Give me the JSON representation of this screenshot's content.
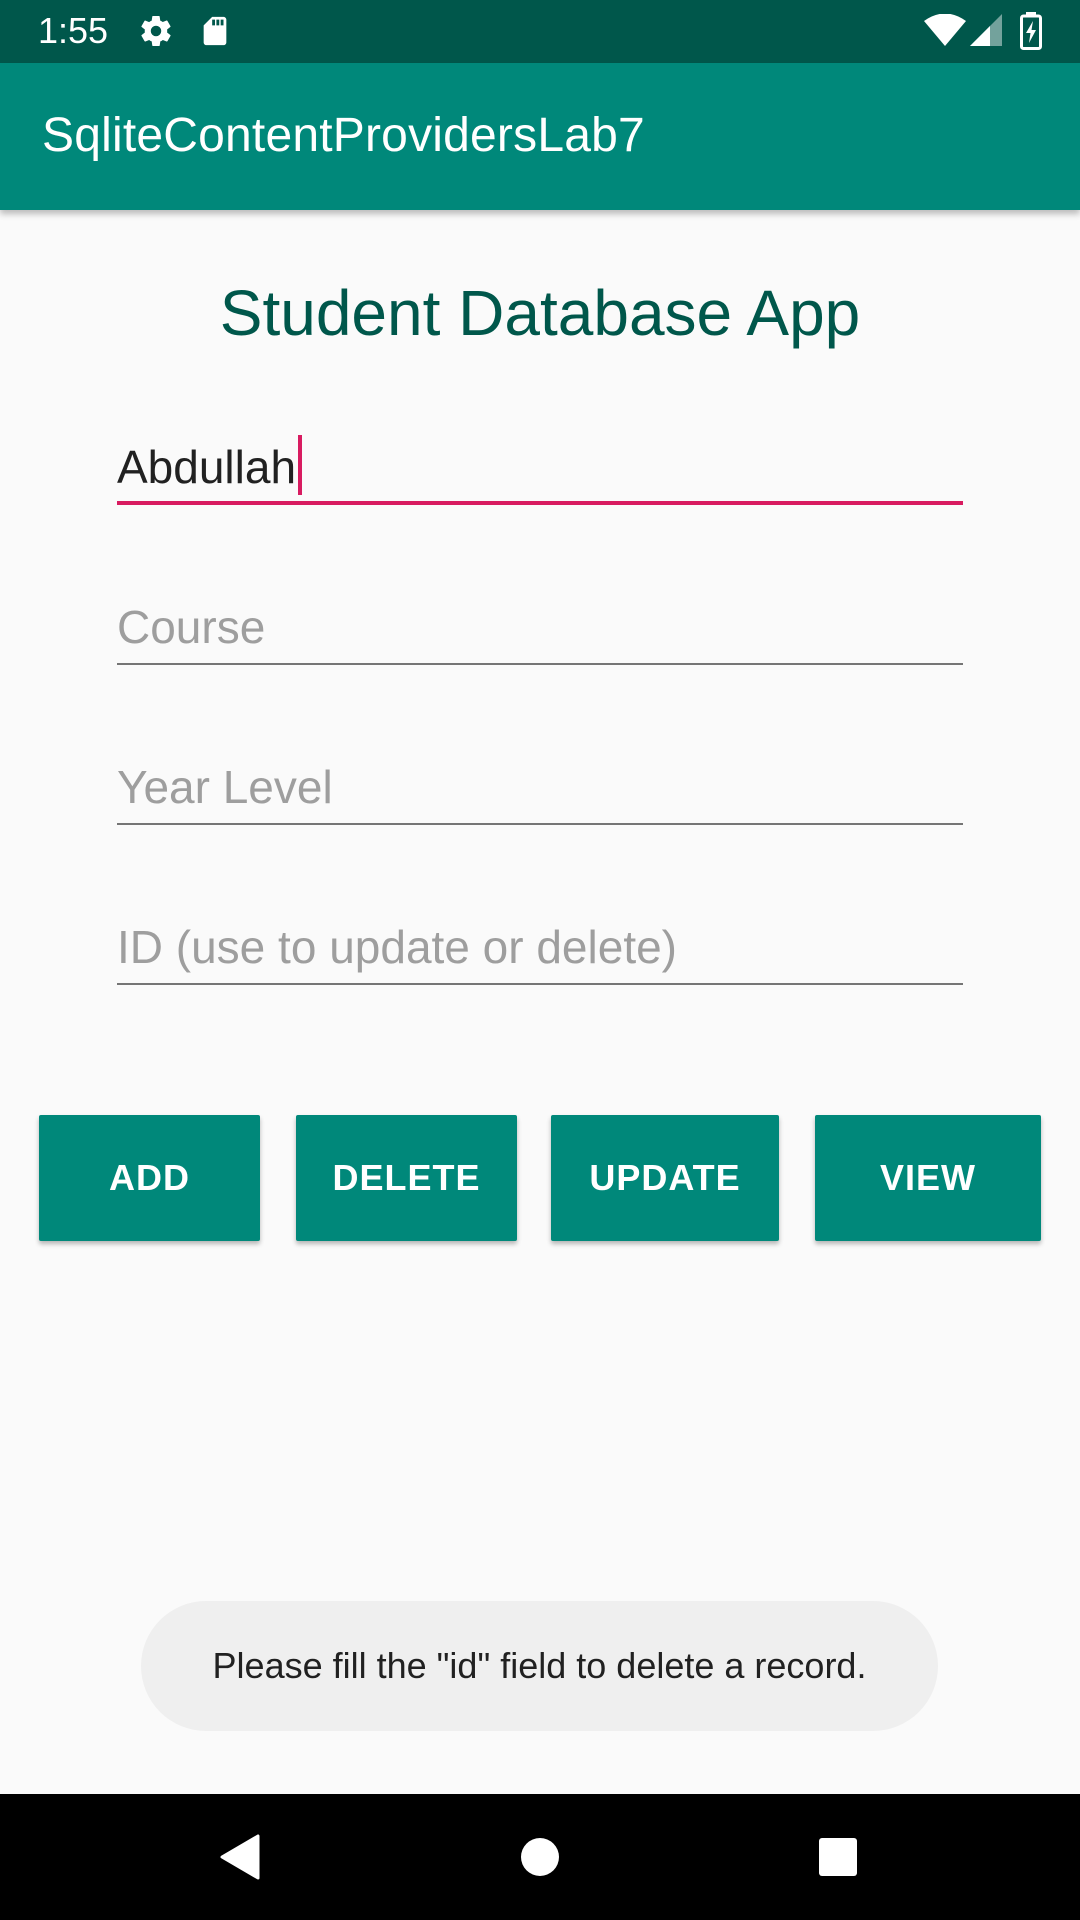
{
  "status_bar": {
    "time": "1:55",
    "icons": [
      "gear-icon",
      "sd-card-icon",
      "wifi-icon",
      "signal-icon",
      "battery-charging-icon"
    ]
  },
  "app_bar": {
    "title": "SqliteContentProvidersLab7"
  },
  "main": {
    "heading": "Student Database App",
    "fields": [
      {
        "name": "name",
        "value": "Abdullah",
        "placeholder": "",
        "focused": true
      },
      {
        "name": "course",
        "value": "",
        "placeholder": "Course"
      },
      {
        "name": "year_level",
        "value": "",
        "placeholder": "Year Level"
      },
      {
        "name": "id",
        "value": "",
        "placeholder": "ID (use to update or delete)"
      }
    ],
    "buttons": {
      "add": "ADD",
      "delete": "DELETE",
      "update": "UPDATE",
      "view": "VIEW"
    }
  },
  "toast": {
    "message": "Please fill the \"id\" field to delete a record."
  },
  "nav_bar": {
    "icons": [
      "back-icon",
      "home-icon",
      "recents-icon"
    ]
  },
  "colors": {
    "status_bar": "#00574b",
    "primary": "#00887a",
    "accent": "#d81b60",
    "heading": "#00574b",
    "background": "#fafafa"
  }
}
